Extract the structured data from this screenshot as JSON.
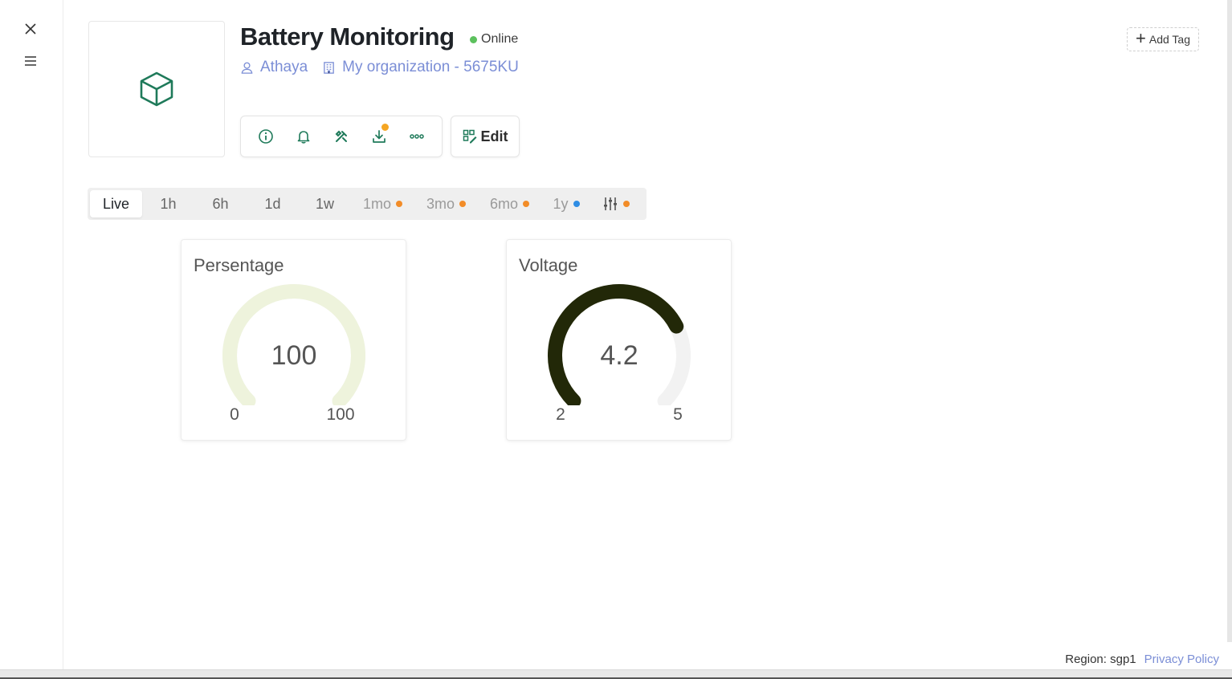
{
  "device": {
    "title": "Battery Monitoring",
    "status": "Online",
    "owner": "Athaya",
    "organization": "My organization - 5675KU",
    "icon": "cube-icon"
  },
  "actions": {
    "add_tag": "Add Tag",
    "edit": "Edit"
  },
  "range_tabs": [
    {
      "label": "Live",
      "dot": null
    },
    {
      "label": "1h",
      "dot": null
    },
    {
      "label": "6h",
      "dot": null
    },
    {
      "label": "1d",
      "dot": null
    },
    {
      "label": "1w",
      "dot": null
    },
    {
      "label": "1mo",
      "dot": "#f28c28"
    },
    {
      "label": "3mo",
      "dot": "#f28c28"
    },
    {
      "label": "6mo",
      "dot": "#f28c28"
    },
    {
      "label": "1y",
      "dot": "#2f8de4"
    }
  ],
  "widgets": [
    {
      "title": "Persentage",
      "value": "100",
      "min": "0",
      "max": "100",
      "fraction": 1.0,
      "color": "#eef3dc"
    },
    {
      "title": "Voltage",
      "value": "4.2",
      "min": "2",
      "max": "5",
      "fraction": 0.733,
      "color": "#222808"
    }
  ],
  "footer": {
    "region": "Region: sgp1",
    "privacy": "Privacy Policy"
  },
  "colors": {
    "accent": "#1f7a5a",
    "link": "#7b8ed6",
    "online": "#5cc15d"
  }
}
